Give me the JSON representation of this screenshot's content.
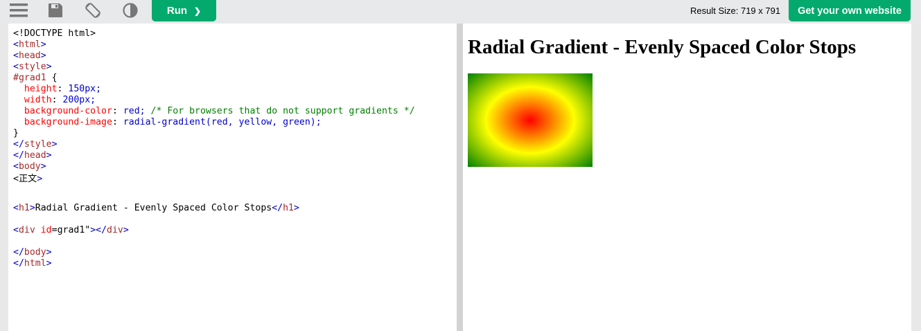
{
  "toolbar": {
    "menu_icon": "hamburger-menu-icon",
    "save_icon": "save-icon",
    "rotate_icon": "rotate-orientation-icon",
    "theme_icon": "contrast-theme-icon",
    "run_label": "Run",
    "run_chevron": "❯",
    "result_size": "Result Size: 719 x 791",
    "get_website_label": "Get your own website",
    "accent_color": "#04aa6d"
  },
  "editor": {
    "lines": [
      "<!DOCTYPE html>",
      "<html>",
      "<head>",
      "<style>",
      "#grad1 {",
      "  height: 150px;",
      "  width: 200px;",
      "  background-color: red; /* For browsers that do not support gradients */",
      "  background-image: radial-gradient(red, yellow, green);",
      "}",
      "</style>",
      "</head>",
      "<body>",
      "<正文>",
      "",
      "<h1>Radial Gradient - Evenly Spaced Color Stops</h1>",
      "",
      "<div id=\"grad1\"></div>",
      "",
      "</body>",
      "</html>"
    ]
  },
  "result": {
    "heading": "Radial Gradient - Evenly Spaced Color Stops",
    "gradient_colors": [
      "red",
      "yellow",
      "green"
    ]
  }
}
